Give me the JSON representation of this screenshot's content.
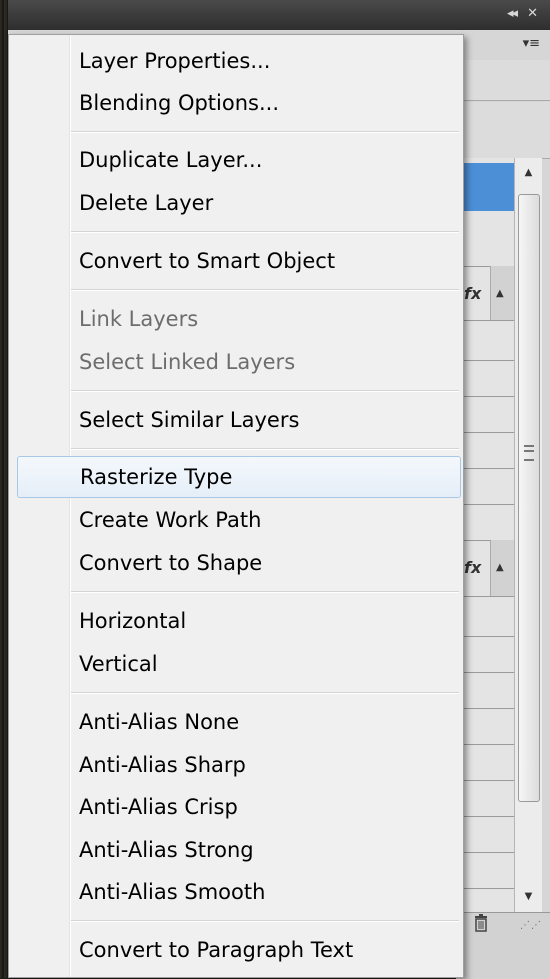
{
  "panel": {
    "collapse_icon": "double-left-arrow-icon",
    "close_icon": "close-icon",
    "menu_icon": "panel-menu-icon",
    "collapse_glyph": "◂◂",
    "close_glyph": "✕",
    "menu_glyph": "▾≡",
    "fx_label_1": "fx",
    "fx_label_2": "fx",
    "selected_color": "#4d8fd6"
  },
  "menu": {
    "items": [
      {
        "label": "Layer Properties...",
        "enabled": true
      },
      {
        "label": "Blending Options...",
        "enabled": true
      },
      {
        "label": "Duplicate Layer...",
        "enabled": true
      },
      {
        "label": "Delete Layer",
        "enabled": true
      },
      {
        "label": "Convert to Smart Object",
        "enabled": true
      },
      {
        "label": "Link Layers",
        "enabled": false
      },
      {
        "label": "Select Linked Layers",
        "enabled": false
      },
      {
        "label": "Select Similar Layers",
        "enabled": true
      },
      {
        "label": "Rasterize Type",
        "enabled": true,
        "highlighted": true
      },
      {
        "label": "Create Work Path",
        "enabled": true
      },
      {
        "label": "Convert to Shape",
        "enabled": true
      },
      {
        "label": "Horizontal",
        "enabled": true
      },
      {
        "label": "Vertical",
        "enabled": true
      },
      {
        "label": "Anti-Alias None",
        "enabled": true
      },
      {
        "label": "Anti-Alias Sharp",
        "enabled": true
      },
      {
        "label": "Anti-Alias Crisp",
        "enabled": true
      },
      {
        "label": "Anti-Alias Strong",
        "enabled": true
      },
      {
        "label": "Anti-Alias Smooth",
        "enabled": true
      },
      {
        "label": "Convert to Paragraph Text",
        "enabled": true
      }
    ]
  }
}
